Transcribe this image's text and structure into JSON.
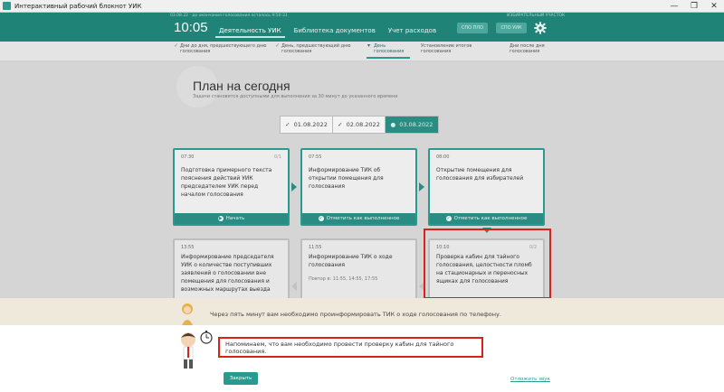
{
  "window": {
    "title": "Интерактивный рабочий блокнот УИК",
    "controls": [
      "—",
      "❐",
      "✕"
    ]
  },
  "header": {
    "status_left": "03.08.22 · до окончания голосования осталось 9:50:31",
    "status_right": "ИЗБИРАТЕЛЬНЫЙ УЧАСТОК",
    "time": "10:05",
    "nav": [
      {
        "label": "Деятельность УИК",
        "active": true
      },
      {
        "label": "Библиотека документов",
        "active": false
      },
      {
        "label": "Учет расходов",
        "active": false
      }
    ],
    "btn1": "СПО ПЛО",
    "btn2": "СПО УИК",
    "settings_icon": "gear-icon"
  },
  "stepper": {
    "steps": [
      {
        "line1": "Дни до дня, предшествующего дню",
        "line2": "голосования",
        "done": true
      },
      {
        "line1": "День, предшествующий дню",
        "line2": "голосования",
        "done": true
      },
      {
        "line1": "День",
        "line2": "голосования",
        "done": false,
        "active": true
      },
      {
        "line1": "Установление итогов",
        "line2": "голосования",
        "done": false
      },
      {
        "line1": "Дни после дня",
        "line2": "голосования",
        "done": false
      }
    ]
  },
  "main": {
    "title": "План на сегодня",
    "subtitle": "Задачи становятся доступными для выполнения за 30 минут до указанного времени",
    "dates": [
      {
        "label": "01.08.2022",
        "icon": "✓",
        "active": false
      },
      {
        "label": "02.08.2022",
        "icon": "✓",
        "active": false
      },
      {
        "label": "03.08.2022",
        "icon": "●",
        "active": true
      }
    ],
    "cards": [
      {
        "time": "07:30",
        "count": "0/1",
        "text": "Подготовка примерного текста пояснения действий УИК председателем УИК перед началом голосования",
        "footer": "Начать",
        "footer_icon": "play-icon"
      },
      {
        "time": "07:55",
        "count": "",
        "text": "Информирование ТИК об открытии помещения для голосования",
        "footer": "Отметить как выполненное",
        "footer_icon": "check-circle-icon"
      },
      {
        "time": "08:00",
        "count": "",
        "text": "Открытие помещения для голосования для избирателей",
        "footer": "Отметить как выполненное",
        "footer_icon": "check-circle-icon"
      },
      {
        "time": "13:55",
        "count": "",
        "text": "Информирование председателя УИК о количестве поступивших заявлений о голосовании вне помещения для голосования и возможных маршрутах выезда",
        "footer": "",
        "footer_icon": ""
      },
      {
        "time": "11:55",
        "count": "",
        "text": "Информирование ТИК о ходе голосования",
        "note": "Повтор в: 11:55, 14:55, 17:55",
        "footer": "",
        "footer_icon": ""
      },
      {
        "time": "10:10",
        "count": "0/2",
        "text": "Проверка кабин для тайного голосования, целостности пломб на стационарных и переносных ящиках для голосования",
        "footer": "",
        "footer_icon": ""
      }
    ]
  },
  "notice": {
    "text": "Через пять минут вам необходимо проинформировать ТИК о ходе голосования по телефону."
  },
  "reminder": {
    "message": "Напоминаем, что вам необходимо провести проверку кабин для тайного голосования.",
    "close_label": "Закрыть",
    "snooze_label": "Отложить звук",
    "timer_icon": "stopwatch-icon"
  }
}
